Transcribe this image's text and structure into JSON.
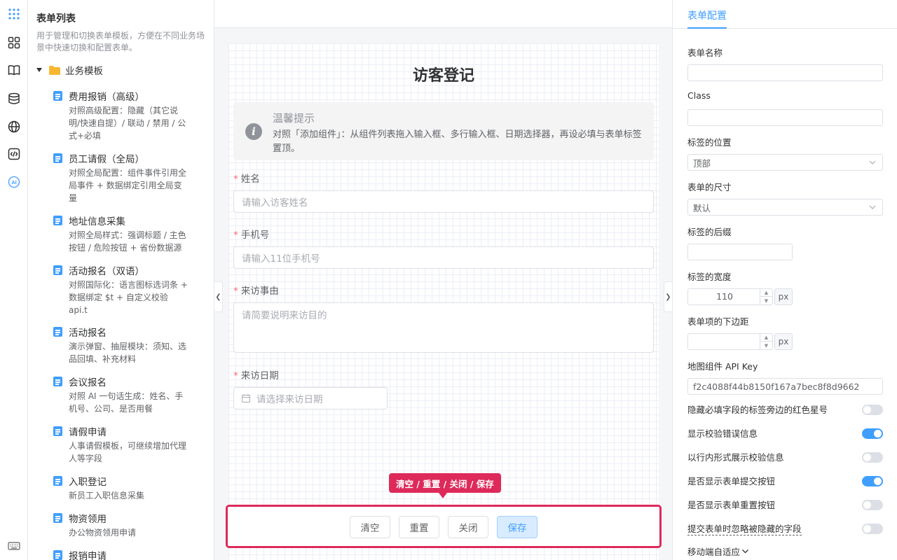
{
  "rail": {
    "icons": [
      "apps-icon",
      "components-icon",
      "book-icon",
      "database-icon",
      "globe-icon",
      "code-icon",
      "ai-icon",
      "keyboard-icon"
    ],
    "ai_label": "AI"
  },
  "form_list": {
    "title": "表单列表",
    "description": "用于管理和切换表单模板，方便在不同业务场景中快速切换和配置表单。",
    "folder": "业务模板",
    "items": [
      {
        "name": "费用报销（高级）",
        "desc": "对照高级配置：隐藏（其它说明/快速自提）/ 联动 / 禁用 / 公式+必填"
      },
      {
        "name": "员工请假（全局）",
        "desc": "对照全局配置：组件事件引用全局事件 + 数据绑定引用全局变量"
      },
      {
        "name": "地址信息采集",
        "desc": "对照全局样式：强调标题 / 主色按钮 / 危险按钮 + 省份数据源"
      },
      {
        "name": "活动报名（双语）",
        "desc": "对照国际化：语言图标选词条 + 数据绑定 $t + 自定义校验 api.t"
      },
      {
        "name": "活动报名",
        "desc": "演示弹窗、抽屉模块：须知、选品回填、补充材料"
      },
      {
        "name": "会议报名",
        "desc": "对照 AI 一句话生成：姓名、手机号、公司、是否用餐"
      },
      {
        "name": "请假申请",
        "desc": "人事请假模板，可继续增加代理人等字段"
      },
      {
        "name": "入职登记",
        "desc": "新员工入职信息采集"
      },
      {
        "name": "物资领用",
        "desc": "办公物资领用申请"
      },
      {
        "name": "报销申请",
        "desc": ""
      }
    ]
  },
  "canvas": {
    "form_title": "访客登记",
    "alert": {
      "title": "温馨提示",
      "description": "对照「添加组件」：从组件列表拖入输入框、多行输入框、日期选择器，再设必填与表单标签置顶。"
    },
    "fields": [
      {
        "label": "姓名",
        "required": "*",
        "placeholder": "请输入访客姓名"
      },
      {
        "label": "手机号",
        "required": "*",
        "placeholder": "请输入11位手机号"
      },
      {
        "label": "来访事由",
        "required": "*",
        "placeholder": "请简要说明来访目的"
      },
      {
        "label": "来访日期",
        "required": "*",
        "placeholder": "请选择来访日期"
      }
    ],
    "buttons": {
      "clear": "清空",
      "reset": "重置",
      "close": "关闭",
      "save": "保存"
    },
    "tooltip": "清空 / 重置 / 关闭 / 保存"
  },
  "config": {
    "tab": "表单配置",
    "form_name_label": "表单名称",
    "form_name_value": "",
    "class_label": "Class",
    "class_value": "",
    "label_position_label": "标签的位置",
    "label_position_value": "顶部",
    "form_size_label": "表单的尺寸",
    "form_size_value": "默认",
    "label_suffix_label": "标签的后缀",
    "label_suffix_value": "",
    "label_width_label": "标签的宽度",
    "label_width_value": "110",
    "label_width_unit": "px",
    "item_margin_label": "表单项的下边距",
    "item_margin_value": "",
    "item_margin_unit": "px",
    "map_key_label": "地图组件 API Key",
    "map_key_value": "f2c4088f44b8150f167a7bec8f8d9662",
    "switches": [
      {
        "label": "隐藏必填字段的标签旁边的红色星号",
        "on": false
      },
      {
        "label": "显示校验错误信息",
        "on": true
      },
      {
        "label": "以行内形式展示校验信息",
        "on": false
      },
      {
        "label": "是否显示表单提交按钮",
        "on": true
      },
      {
        "label": "是否显示表单重置按钮",
        "on": false
      },
      {
        "label": "提交表单时忽略被隐藏的字段",
        "on": false
      }
    ],
    "mobile_label": "移动端自适应"
  },
  "colors": {
    "primary": "#409eff",
    "highlight": "#dd2a5b",
    "required": "#f56c6c"
  }
}
